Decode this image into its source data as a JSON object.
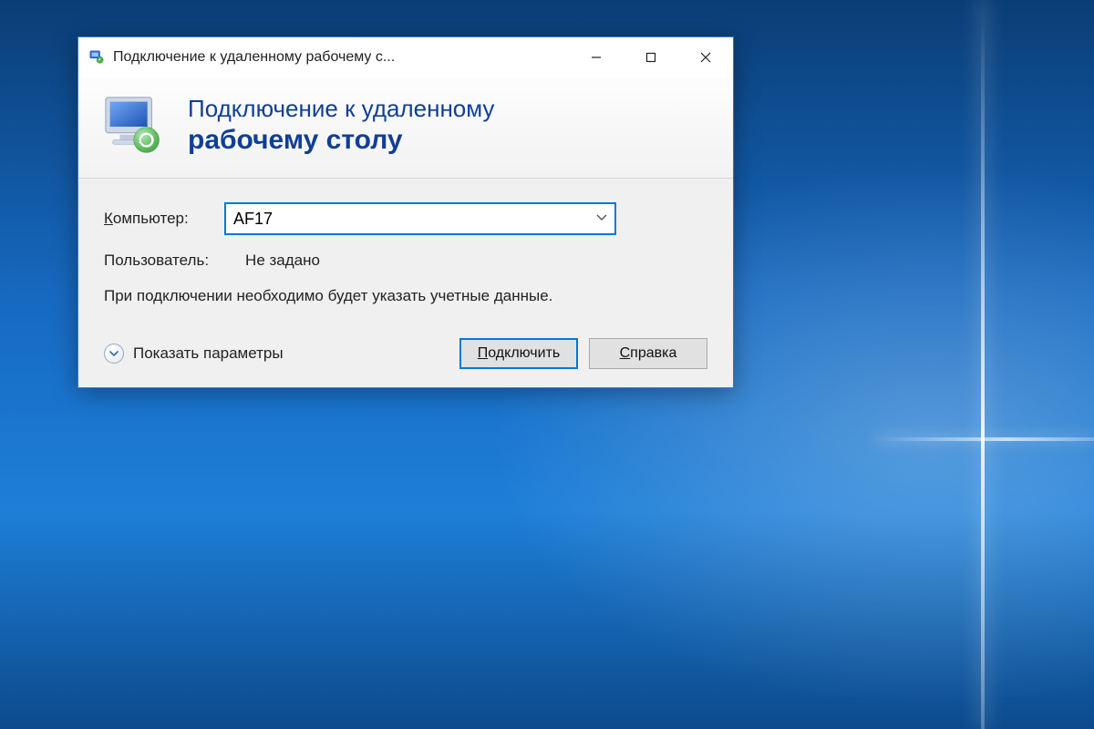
{
  "window": {
    "title": "Подключение к удаленному рабочему с..."
  },
  "banner": {
    "line1": "Подключение к удаленному",
    "line2": "рабочему столу"
  },
  "form": {
    "computer_label_pre": "К",
    "computer_label_rest": "омпьютер:",
    "computer_value": "AF17",
    "user_label": "Пользователь:",
    "user_value": "Не задано",
    "info": "При подключении необходимо будет указать учетные данные."
  },
  "footer": {
    "show_options_underline": "П",
    "show_options_rest": "оказать параметры",
    "connect_underline": "П",
    "connect_rest": "одключить",
    "help_underline": "С",
    "help_rest": "правка"
  }
}
